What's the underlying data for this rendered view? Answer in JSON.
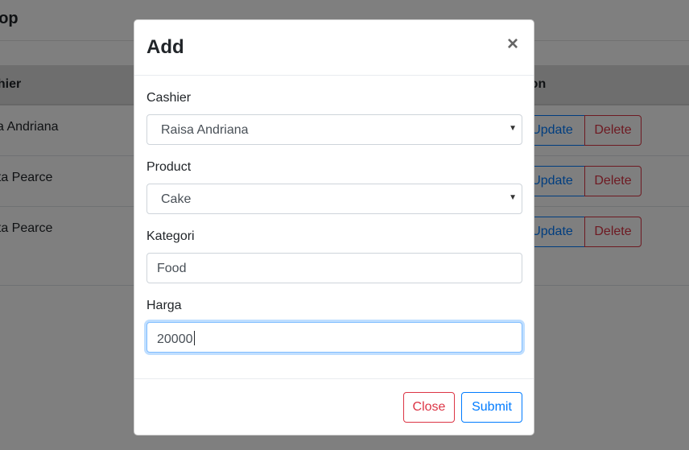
{
  "page": {
    "brand": "hop",
    "table": {
      "headers": {
        "cashier": "shier",
        "action": "ction"
      },
      "rows": [
        {
          "name": "sa Andriana"
        },
        {
          "name": "rita Pearce"
        },
        {
          "name": "rita Pearce"
        }
      ],
      "update_label": "Update",
      "delete_label": "Delete"
    }
  },
  "modal": {
    "title": "Add",
    "close_symbol": "×",
    "fields": {
      "cashier": {
        "label": "Cashier",
        "value": "Raisa Andriana"
      },
      "product": {
        "label": "Product",
        "value": "Cake"
      },
      "kategori": {
        "label": "Kategori",
        "value": "Food"
      },
      "harga": {
        "label": "Harga",
        "value": "20000"
      }
    },
    "footer": {
      "close_label": "Close",
      "submit_label": "Submit"
    }
  },
  "icons": {
    "close": "close-icon",
    "select_caret": "caret-down-icon"
  },
  "colors": {
    "primary": "#007bff",
    "danger": "#dc3545",
    "backdrop": "rgba(0,0,0,0.5)"
  }
}
